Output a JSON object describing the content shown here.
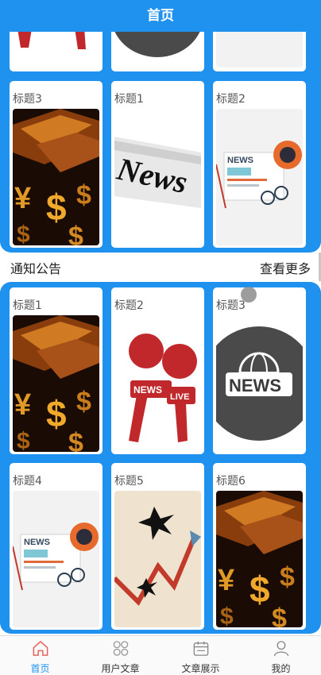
{
  "header": {
    "title": "首页"
  },
  "top_cards": [
    {
      "title": "标题3",
      "image": "gold-dollar-image"
    },
    {
      "title": "标题1",
      "image": "newspaper-image"
    },
    {
      "title": "标题2",
      "image": "news-laptop-image"
    }
  ],
  "section": {
    "title": "通知公告",
    "more": "查看更多"
  },
  "bottom_cards": [
    {
      "title": "标题1",
      "image": "gold-dollar-image"
    },
    {
      "title": "标题2",
      "image": "news-microphone-image"
    },
    {
      "title": "标题3",
      "image": "news-globe-image"
    },
    {
      "title": "标题4",
      "image": "news-laptop-image"
    },
    {
      "title": "标题5",
      "image": "chart-arrow-image"
    },
    {
      "title": "标题6",
      "image": "gold-dollar-image"
    }
  ],
  "tabbar": [
    {
      "label": "首页",
      "icon": "home-icon",
      "active": true
    },
    {
      "label": "用户文章",
      "icon": "grid-icon",
      "active": false
    },
    {
      "label": "文章展示",
      "icon": "calendar-icon",
      "active": false
    },
    {
      "label": "我的",
      "icon": "user-icon",
      "active": false
    }
  ],
  "colors": {
    "primary": "#1e92ee",
    "card": "#ffffff"
  }
}
